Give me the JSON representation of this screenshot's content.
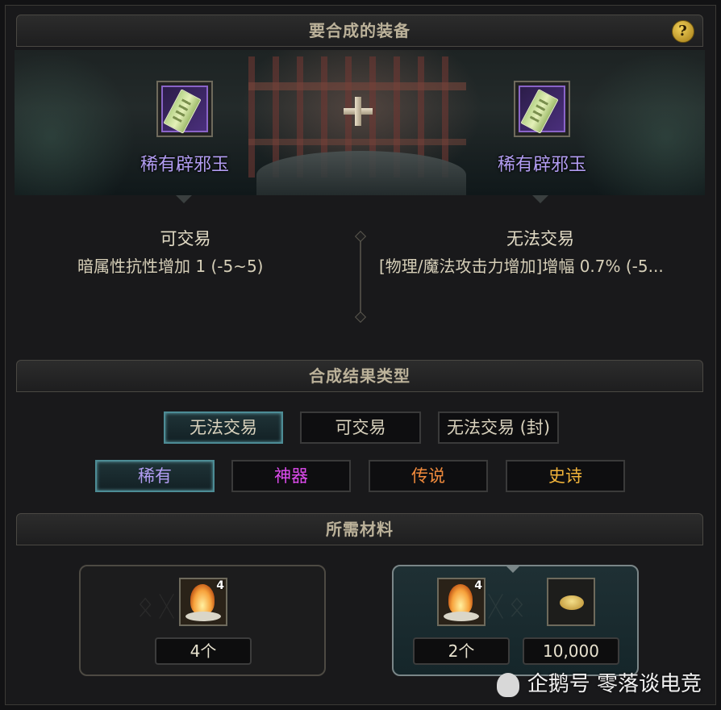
{
  "header_equipment": {
    "title": "要合成的装备",
    "help": "?"
  },
  "left_item": {
    "name": "稀有辟邪玉",
    "trade": "可交易",
    "attribute": "暗属性抗性增加 1 (-5~5)"
  },
  "right_item": {
    "name": "稀有辟邪玉",
    "trade": "无法交易",
    "attribute": "[物理/魔法攻击力增加]增幅 0.7% (-5..."
  },
  "header_result": {
    "title": "合成结果类型"
  },
  "trade_options": [
    {
      "label": "无法交易",
      "selected": true
    },
    {
      "label": "可交易",
      "selected": false
    },
    {
      "label": "无法交易 (封)",
      "selected": false
    }
  ],
  "rarity_options": [
    {
      "label": "稀有",
      "selected": true,
      "color": "#b29df2"
    },
    {
      "label": "神器",
      "selected": false,
      "color": "#e04cf0"
    },
    {
      "label": "传说",
      "selected": false,
      "color": "#f08a3c"
    },
    {
      "label": "史诗",
      "selected": false,
      "color": "#f2b43a"
    }
  ],
  "header_materials": {
    "title": "所需材料"
  },
  "material_left": {
    "stack": "4",
    "count": "4个"
  },
  "material_right": {
    "stack": "4",
    "count": "2个",
    "gold": "10,000"
  },
  "watermark": "企鹅号 零落谈电竞"
}
